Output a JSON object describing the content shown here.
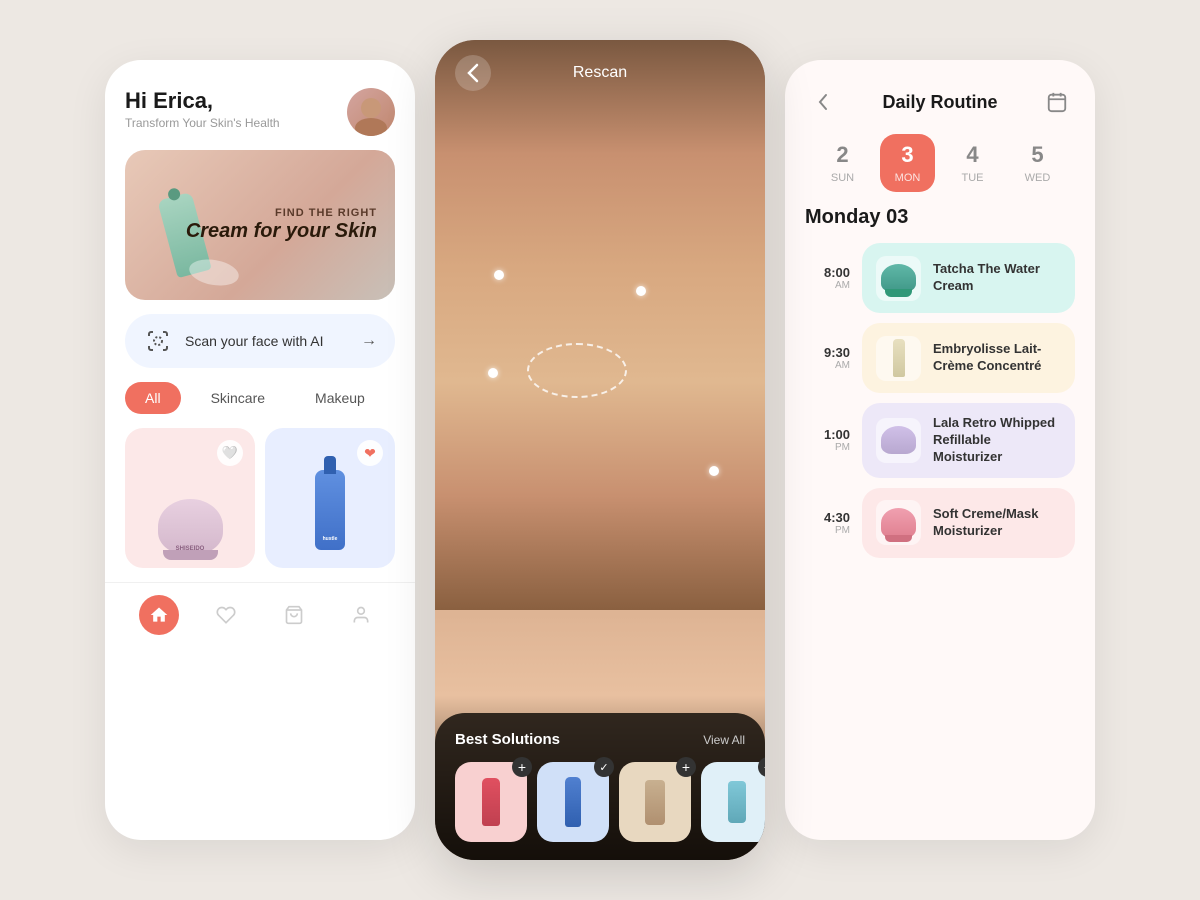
{
  "app": {
    "background_color": "#ede8e3"
  },
  "panel1": {
    "greeting": "Hi Erica,",
    "subtitle": "Transform Your Skin's Health",
    "hero": {
      "find_text": "FIND THE RIGHT",
      "big_text": "Cream for your Skin"
    },
    "scan_button": {
      "label": "Scan your face with AI",
      "icon": "scan-icon"
    },
    "filters": {
      "all": "All",
      "skincare": "Skincare",
      "makeup": "Makeup"
    },
    "products": [
      {
        "name": "Shiseido",
        "bg": "pink-bg",
        "heart_filled": false
      },
      {
        "name": "if you hustle",
        "bg": "blue-bg",
        "heart_filled": true
      }
    ],
    "nav": {
      "home": "⌂",
      "heart": "♡",
      "bag": "◻",
      "profile": "⊙"
    }
  },
  "panel2": {
    "title": "Rescan",
    "back_label": "‹",
    "best_solutions_label": "Best Solutions",
    "view_all_label": "View All",
    "products": [
      {
        "id": 1,
        "bg": "pink-item",
        "action": "add"
      },
      {
        "id": 2,
        "bg": "blue-item",
        "action": "check"
      },
      {
        "id": 3,
        "bg": "beige-item",
        "action": "add"
      },
      {
        "id": 4,
        "bg": "light-item",
        "action": "add"
      }
    ]
  },
  "panel3": {
    "title": "Daily Routine",
    "date_heading": "Monday 03",
    "calendar": [
      {
        "num": "2",
        "name": "SUN",
        "active": false
      },
      {
        "num": "3",
        "name": "MON",
        "active": true
      },
      {
        "num": "4",
        "name": "TUE",
        "active": false
      },
      {
        "num": "5",
        "name": "WED",
        "active": false
      }
    ],
    "items": [
      {
        "time": "8:00",
        "ampm": "AM",
        "name": "Tatcha The Water Cream",
        "card_color": "teal-card",
        "thumb_color": "thumb-teal",
        "shape": "teal-jar"
      },
      {
        "time": "9:30",
        "ampm": "AM",
        "name": "Embryolisse Lait-Crème Concentré",
        "card_color": "yellow-card",
        "thumb_color": "thumb-yellow",
        "shape": "yellow-tube"
      },
      {
        "time": "1:00",
        "ampm": "PM",
        "name": "Lala Retro Whipped Refillable Moisturizer",
        "card_color": "purple-card",
        "thumb_color": "thumb-purple",
        "shape": "purple-jar"
      },
      {
        "time": "4:30",
        "ampm": "PM",
        "name": "Soft Creme/Mask Moisturizer",
        "card_color": "pink-card",
        "thumb_color": "thumb-pink",
        "shape": "pink-jar"
      }
    ]
  }
}
